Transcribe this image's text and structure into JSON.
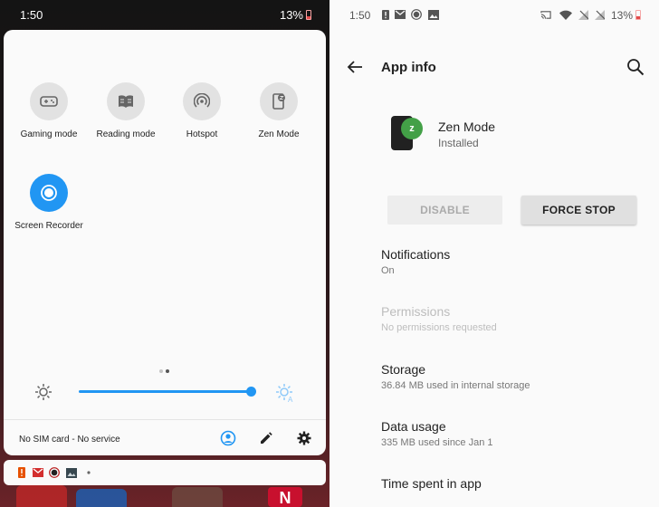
{
  "left": {
    "status_time": "1:50",
    "battery": "13%",
    "tiles": [
      {
        "label": "Gaming mode",
        "icon": "gamepad-icon"
      },
      {
        "label": "Reading mode",
        "icon": "book-icon"
      },
      {
        "label": "Hotspot",
        "icon": "hotspot-icon"
      },
      {
        "label": "Zen Mode",
        "icon": "zen-mode-icon"
      },
      {
        "label": "Screen Recorder",
        "icon": "record-icon",
        "active": true
      }
    ],
    "brightness_level": 0.97,
    "carrier": "No SIM card - No service",
    "accent": "#2196f3"
  },
  "right": {
    "status_time": "1:50",
    "battery": "13%",
    "title": "App info",
    "app": {
      "name": "Zen Mode",
      "status": "Installed",
      "badge": "z"
    },
    "buttons": {
      "disable": "DISABLE",
      "force_stop": "FORCE STOP"
    },
    "prefs": [
      {
        "title": "Notifications",
        "summary": "On"
      },
      {
        "title": "Permissions",
        "summary": "No permissions requested",
        "disabled": true
      },
      {
        "title": "Storage",
        "summary": "36.84 MB used in internal storage"
      },
      {
        "title": "Data usage",
        "summary": "335 MB used since Jan 1"
      },
      {
        "title": "Time spent in app",
        "summary": ""
      }
    ],
    "badge_color": "#43a047"
  }
}
